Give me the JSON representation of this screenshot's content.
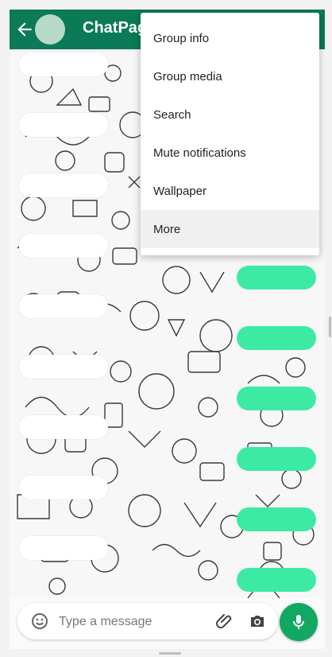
{
  "appbar": {
    "title": "ChatPage",
    "back_icon": "arrow-left-icon",
    "color": "#0b7a57"
  },
  "menu": {
    "items": [
      {
        "label": "Group info"
      },
      {
        "label": "Group media"
      },
      {
        "label": "Search"
      },
      {
        "label": "Mute notifications"
      },
      {
        "label": "Wallpaper"
      },
      {
        "label": "More",
        "highlighted": true
      }
    ]
  },
  "composer": {
    "placeholder": "Type a message",
    "emoji_icon": "emoji-icon",
    "attach_icon": "paperclip-icon",
    "camera_icon": "camera-icon",
    "mic_icon": "mic-icon",
    "mic_color": "#11a862"
  },
  "messages": {
    "incoming_color": "#ffffff",
    "outgoing_color": "#3deaa4"
  }
}
